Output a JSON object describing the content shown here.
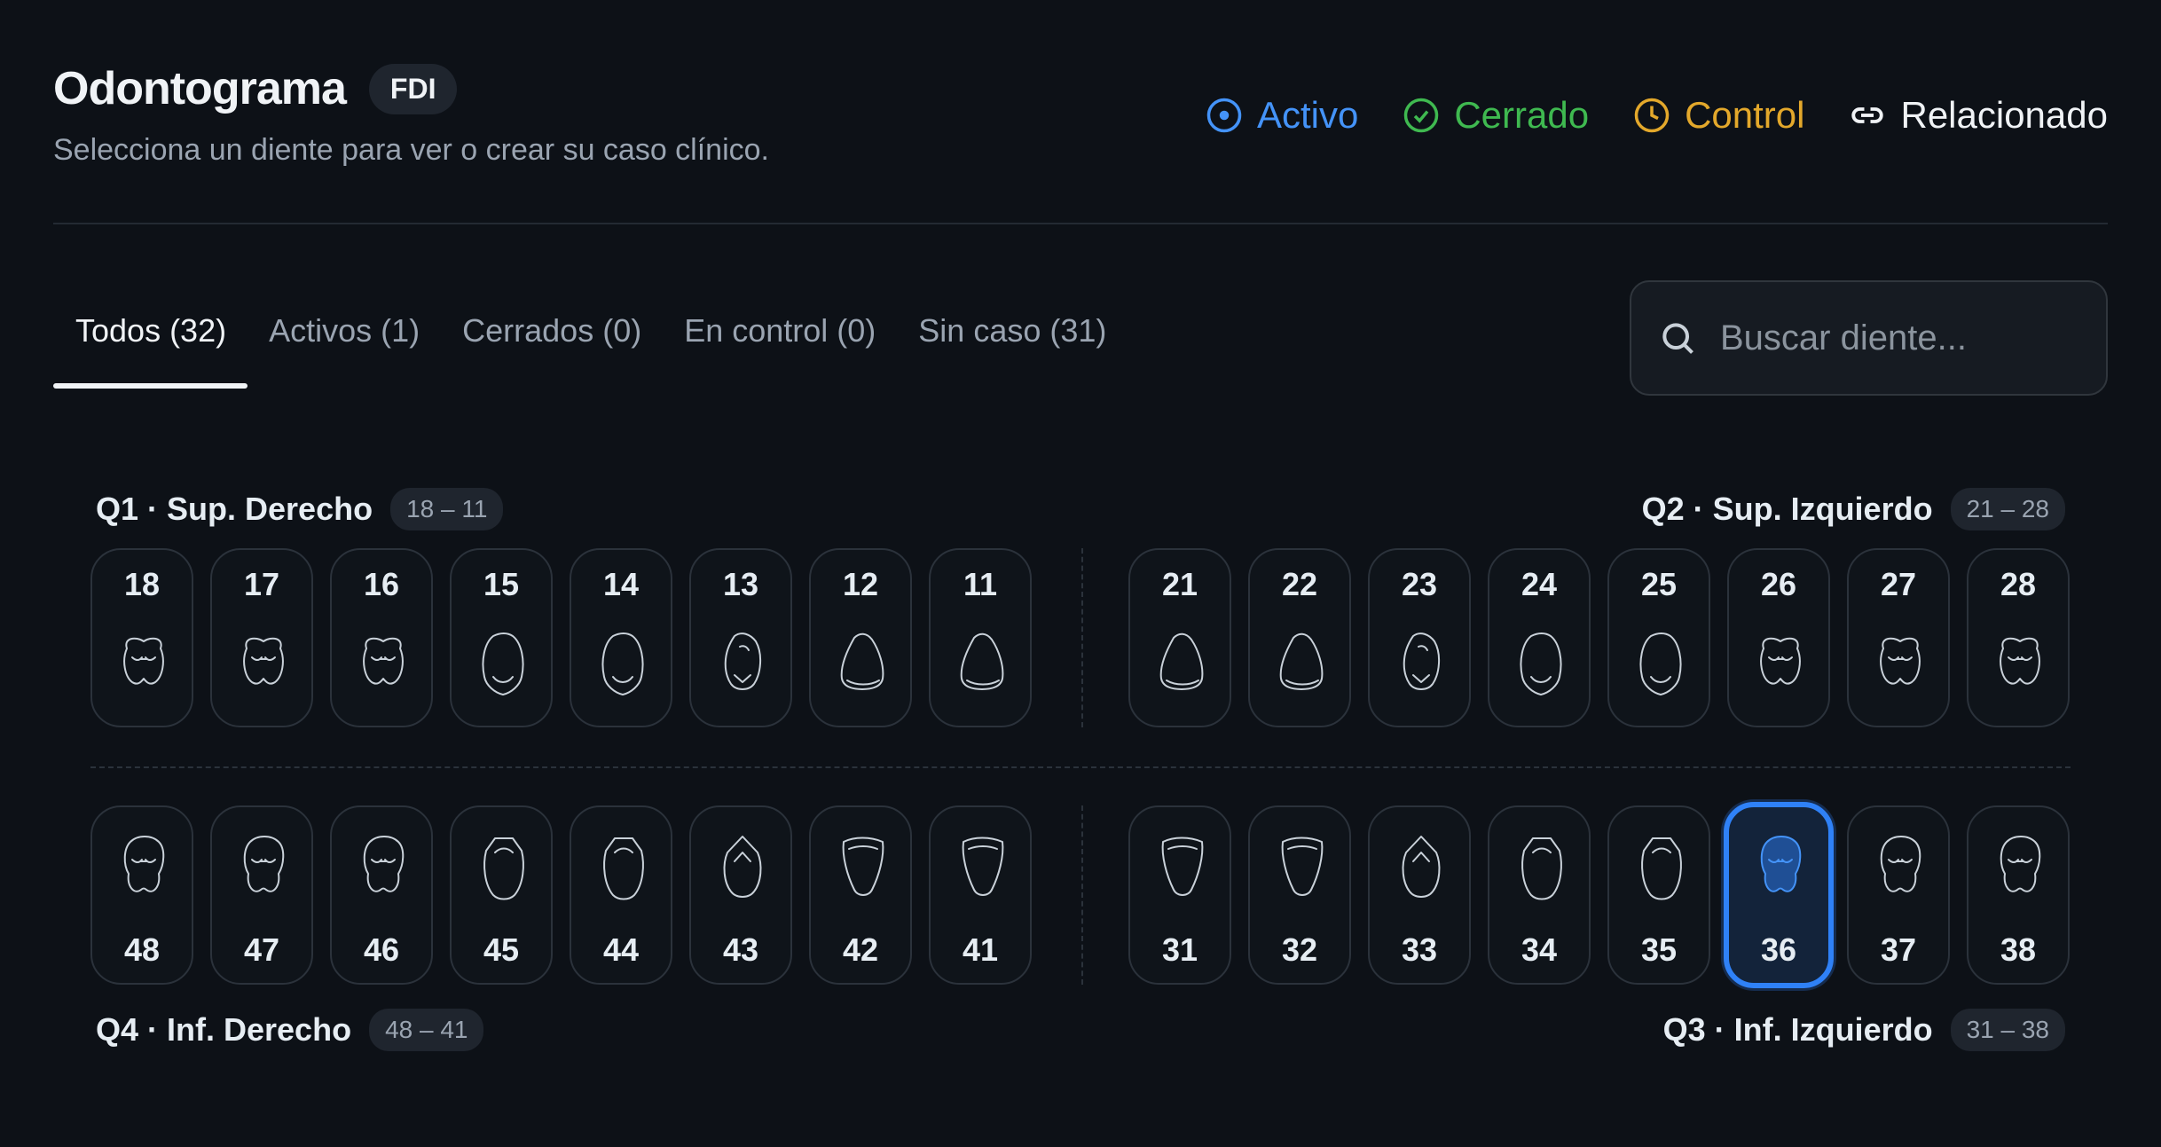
{
  "header": {
    "title": "Odontograma",
    "notation": "FDI",
    "subtitle": "Selecciona un diente para ver o crear su caso clínico."
  },
  "legend": [
    {
      "label": "Activo",
      "color": "#4493f8",
      "icon": "target-icon"
    },
    {
      "label": "Cerrado",
      "color": "#3fb950",
      "icon": "check-circle-icon"
    },
    {
      "label": "Control",
      "color": "#e3a82b",
      "icon": "clock-icon"
    },
    {
      "label": "Relacionado",
      "color": "#f0f3f6",
      "icon": "link-icon"
    }
  ],
  "tabs": [
    {
      "label": "Todos (32)",
      "active": true
    },
    {
      "label": "Activos (1)"
    },
    {
      "label": "Cerrados (0)"
    },
    {
      "label": "En control (0)"
    },
    {
      "label": "Sin caso (31)"
    }
  ],
  "search": {
    "placeholder": "Buscar diente..."
  },
  "quadrants": {
    "q1": {
      "label": "Q1 · Sup. Derecho",
      "range": "18 – 11"
    },
    "q2": {
      "label": "Q2 · Sup. Izquierdo",
      "range": "21 – 28"
    },
    "q3": {
      "label": "Q3 · Inf. Izquierdo",
      "range": "31 – 38"
    },
    "q4": {
      "label": "Q4 · Inf. Derecho",
      "range": "48 – 41"
    }
  },
  "teeth": {
    "upper_right": [
      "18",
      "17",
      "16",
      "15",
      "14",
      "13",
      "12",
      "11"
    ],
    "upper_left": [
      "21",
      "22",
      "23",
      "24",
      "25",
      "26",
      "27",
      "28"
    ],
    "lower_right": [
      "48",
      "47",
      "46",
      "45",
      "44",
      "43",
      "42",
      "41"
    ],
    "lower_left": [
      "31",
      "32",
      "33",
      "34",
      "35",
      "36",
      "37",
      "38"
    ]
  },
  "selected_tooth": "36",
  "colors": {
    "accent": "#2f81f7",
    "background": "#0d1117"
  }
}
